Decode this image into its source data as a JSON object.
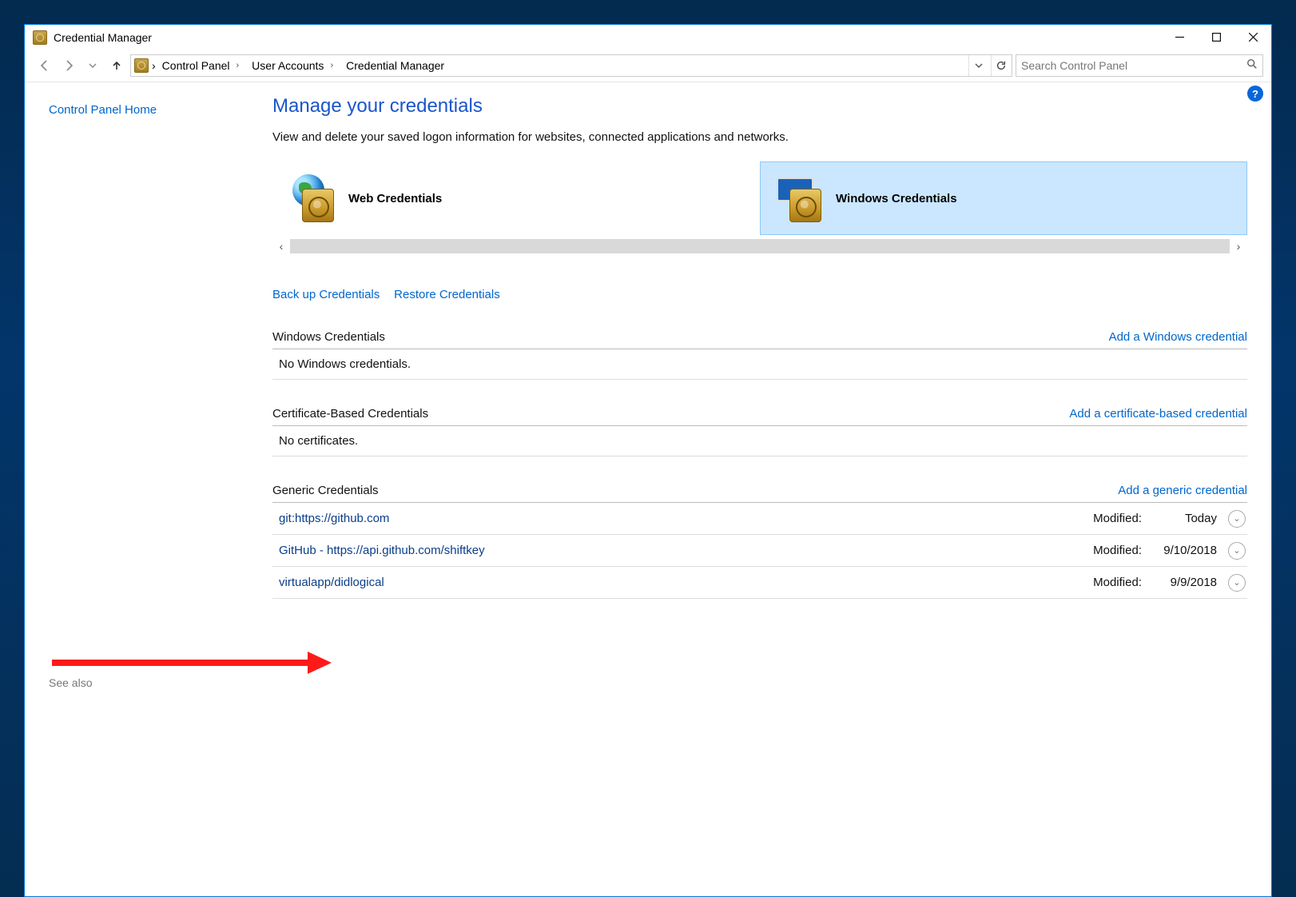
{
  "window": {
    "title": "Credential Manager"
  },
  "breadcrumb": [
    "Control Panel",
    "User Accounts",
    "Credential Manager"
  ],
  "search": {
    "placeholder": "Search Control Panel"
  },
  "sidebar": {
    "home": "Control Panel Home",
    "seealso": "See also"
  },
  "heading": "Manage your credentials",
  "description": "View and delete your saved logon information for websites, connected applications and networks.",
  "kinds": {
    "web": "Web Credentials",
    "win": "Windows Credentials"
  },
  "actions": {
    "backup": "Back up Credentials",
    "restore": "Restore Credentials"
  },
  "sections": {
    "windows": {
      "label": "Windows Credentials",
      "add": "Add a Windows credential",
      "empty": "No Windows credentials."
    },
    "cert": {
      "label": "Certificate-Based Credentials",
      "add": "Add a certificate-based credential",
      "empty": "No certificates."
    },
    "generic": {
      "label": "Generic Credentials",
      "add": "Add a generic credential"
    }
  },
  "modified_label": "Modified:",
  "generic_items": [
    {
      "name": "git:https://github.com",
      "modified": "Today"
    },
    {
      "name": "GitHub - https://api.github.com/shiftkey",
      "modified": "9/10/2018"
    },
    {
      "name": "virtualapp/didlogical",
      "modified": "9/9/2018"
    }
  ]
}
